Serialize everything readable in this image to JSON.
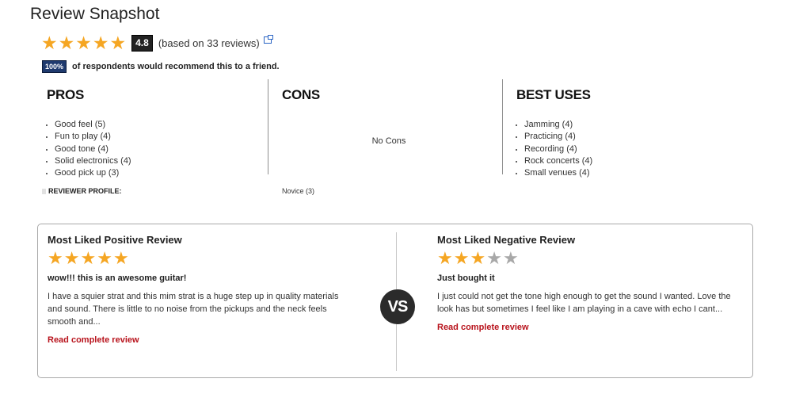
{
  "header": {
    "title": "Review Snapshot"
  },
  "rating": {
    "stars_filled": 5,
    "stars_total": 5,
    "average": "4.8",
    "count_text": "(based on 33 reviews)",
    "star_color": "#f5a623"
  },
  "recommend": {
    "percent": "100%",
    "text": "of respondents would recommend this to a friend."
  },
  "pros": {
    "title": "PROS",
    "items": [
      "Good feel (5)",
      "Fun to play (4)",
      "Good tone (4)",
      "Solid electronics (4)",
      "Good pick up (3)"
    ]
  },
  "cons": {
    "title": "CONS",
    "empty_text": "No Cons"
  },
  "best_uses": {
    "title": "BEST USES",
    "items": [
      "Jamming (4)",
      "Practicing (4)",
      "Recording (4)",
      "Rock concerts (4)",
      "Small venues (4)"
    ]
  },
  "reviewer_profile": {
    "label": "REVIEWER PROFILE:",
    "value": "Novice (3)"
  },
  "compare": {
    "vs_label": "VS",
    "positive": {
      "heading": "Most Liked Positive Review",
      "stars_filled": 5,
      "title": "wow!!! this is an awesome guitar!",
      "body": "I have a squier strat and this mim strat is a huge step up in quality materials and sound. There is little to no noise from the pickups and the neck feels smooth and...",
      "link": "Read complete review"
    },
    "negative": {
      "heading": "Most Liked Negative Review",
      "stars_filled": 3,
      "title": "Just bought it",
      "body": "I just could not get the tone high enough to get the sound I wanted. Love the look has but sometimes I feel like I am playing in a cave with echo I cant...",
      "link": "Read complete review"
    }
  }
}
